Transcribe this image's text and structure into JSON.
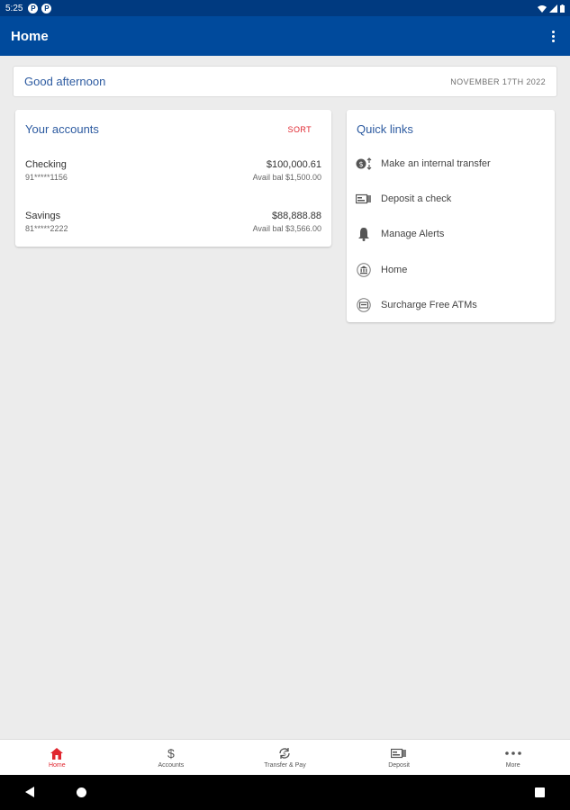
{
  "status_bar": {
    "time": "5:25",
    "notif_1": "P",
    "notif_2": "P"
  },
  "app_bar": {
    "title": "Home"
  },
  "greeting": {
    "text": "Good afternoon",
    "date": "NOVEMBER 17TH 2022"
  },
  "accounts": {
    "title": "Your accounts",
    "sort_label": "SORT",
    "items": [
      {
        "name": "Checking",
        "number": "91*****1156",
        "balance": "$100,000.61",
        "available": "Avail bal $1,500.00"
      },
      {
        "name": "Savings",
        "number": "81*****2222",
        "balance": "$88,888.88",
        "available": "Avail bal $3,566.00"
      }
    ]
  },
  "quick_links": {
    "title": "Quick links",
    "items": [
      {
        "label": "Make an internal transfer",
        "icon": "transfer-icon"
      },
      {
        "label": "Deposit a check",
        "icon": "check-deposit-icon"
      },
      {
        "label": "Manage Alerts",
        "icon": "bell-icon"
      },
      {
        "label": "Home",
        "icon": "bank-icon"
      },
      {
        "label": "Surcharge Free ATMs",
        "icon": "atm-icon"
      }
    ]
  },
  "bottom_nav": {
    "items": [
      {
        "label": "Home",
        "icon": "home-icon"
      },
      {
        "label": "Accounts",
        "icon": "dollar-icon"
      },
      {
        "label": "Transfer & Pay",
        "icon": "transfer-pay-icon"
      },
      {
        "label": "Deposit",
        "icon": "deposit-icon"
      },
      {
        "label": "More",
        "icon": "more-dots-icon"
      }
    ]
  },
  "colors": {
    "primary": "#004a9c",
    "status_bar": "#003a80",
    "accent": "#e0262f",
    "heading": "#2c5aa0",
    "background": "#ececec"
  }
}
